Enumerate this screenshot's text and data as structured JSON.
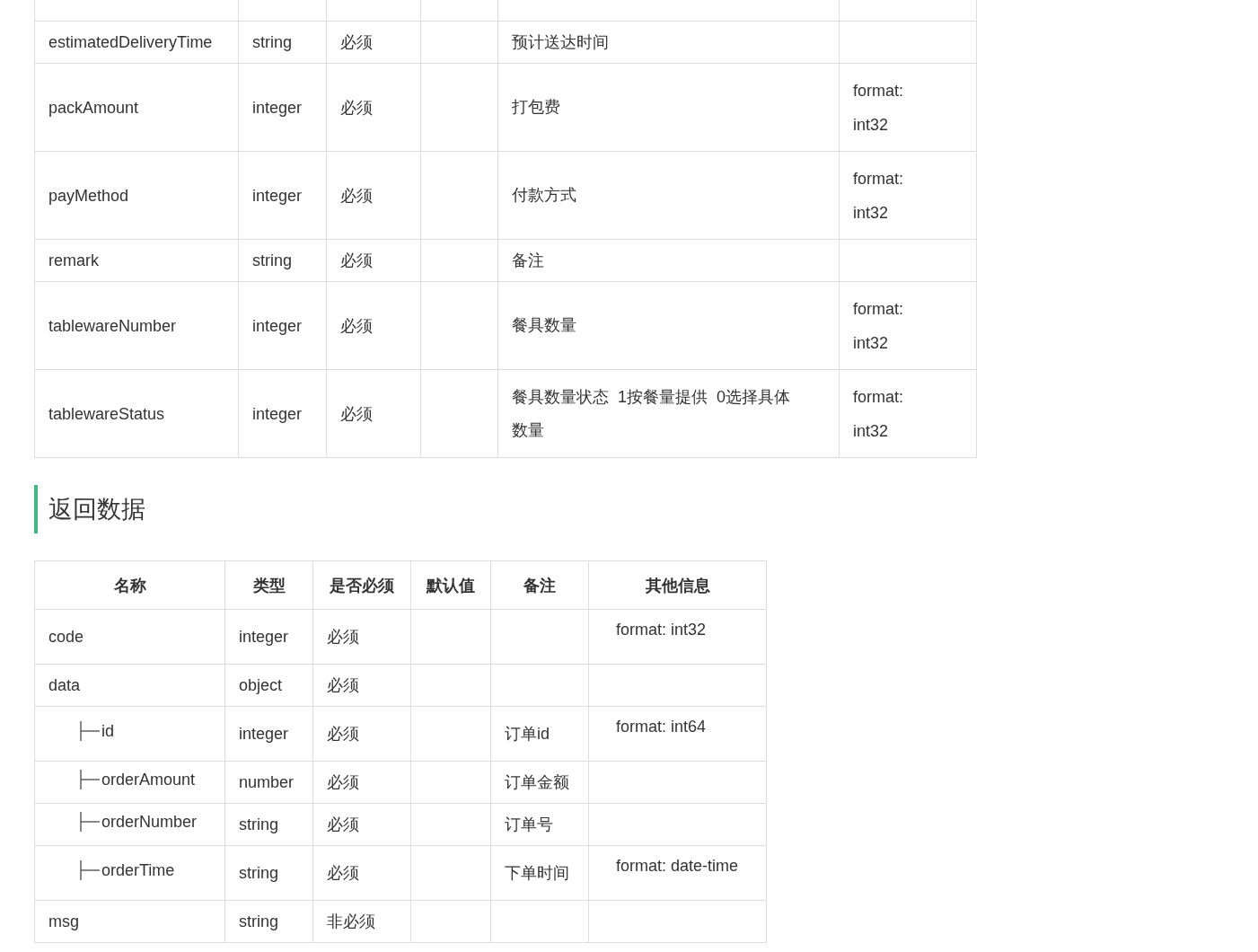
{
  "request_table": {
    "rows": [
      {
        "name": "estimatedDeliveryTime",
        "type": "string",
        "required": "必须",
        "note": "预计送达时间"
      },
      {
        "name": "packAmount",
        "type": "integer",
        "required": "必须",
        "note": "打包费",
        "other": "format: int32"
      },
      {
        "name": "payMethod",
        "type": "integer",
        "required": "必须",
        "note": "付款方式",
        "other": "format: int32"
      },
      {
        "name": "remark",
        "type": "string",
        "required": "必须",
        "note": "备注"
      },
      {
        "name": "tablewareNumber",
        "type": "integer",
        "required": "必须",
        "note": "餐具数量",
        "other": "format: int32"
      },
      {
        "name": "tablewareStatus",
        "type": "integer",
        "required": "必须",
        "note": "餐具数量状态  1按餐量提供  0选择具体数量",
        "other": "format: int32"
      }
    ]
  },
  "section_title": "返回数据",
  "response_table": {
    "columns": [
      "名称",
      "类型",
      "是否必须",
      "默认值",
      "备注",
      "其他信息"
    ],
    "rows": [
      {
        "name": "code",
        "type": "integer",
        "required": "必须",
        "other": "format: int32"
      },
      {
        "name": "data",
        "type": "object",
        "required": "必须",
        "children": [
          {
            "name": "id",
            "type": "integer",
            "required": "必须",
            "note": "订单id",
            "other": "format: int64"
          },
          {
            "name": "orderAmount",
            "type": "number",
            "required": "必须",
            "note": "订单金额"
          },
          {
            "name": "orderNumber",
            "type": "string",
            "required": "必须",
            "note": "订单号"
          },
          {
            "name": "orderTime",
            "type": "string",
            "required": "必须",
            "note": "下单时间",
            "other": "format: date-time"
          }
        ]
      },
      {
        "name": "msg",
        "type": "string",
        "required": "非必须"
      }
    ]
  }
}
